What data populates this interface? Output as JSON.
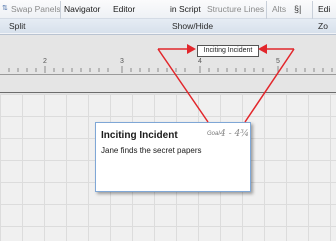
{
  "ribbon": {
    "items": [
      {
        "label": "Swap Panels",
        "dim": true
      },
      {
        "label": "Navigator",
        "dim": false
      },
      {
        "label": "Editor",
        "dim": false
      },
      {
        "label": "in Script",
        "dim": false
      },
      {
        "label": "Structure Lines",
        "dim": true
      },
      {
        "label": "Alts",
        "dim": true
      },
      {
        "label": "Edi",
        "dim": false
      }
    ],
    "groups": {
      "split": "Split",
      "show_hide": "Show/Hide",
      "zoom": "Zo"
    }
  },
  "ruler": {
    "ticks": [
      "2",
      "3",
      "4",
      "5"
    ]
  },
  "marker": {
    "label": "Inciting Incident"
  },
  "card": {
    "title": "Inciting Incident",
    "goal_label": "Goal",
    "goal_value": "4 - 4¾",
    "body": "Jane finds the secret papers"
  },
  "colors": {
    "annotation_arrow": "#e2262b",
    "card_border": "#7fa7d6"
  }
}
